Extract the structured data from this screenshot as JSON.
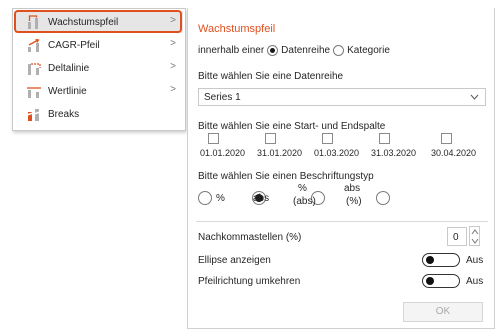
{
  "menu": {
    "items": [
      {
        "label": "Wachstumspfeil",
        "icon": "growth-arrow-icon",
        "submenu": true,
        "active": true
      },
      {
        "label": "CAGR-Pfeil",
        "icon": "cagr-arrow-icon",
        "submenu": true
      },
      {
        "label": "Deltalinie",
        "icon": "delta-line-icon",
        "submenu": true
      },
      {
        "label": "Wertlinie",
        "icon": "value-line-icon",
        "submenu": true
      },
      {
        "label": "Breaks",
        "icon": "breaks-icon",
        "submenu": false
      }
    ],
    "accent_color": "#e0501f",
    "submenu_glyph": ">"
  },
  "panel": {
    "title": "Wachstumspfeil",
    "scope": {
      "label": "innerhalb einer",
      "option_series": "Datenreihe",
      "option_category": "Kategorie",
      "selected": "Datenreihe"
    },
    "series_section": {
      "label": "Bitte wählen Sie eine Datenreihe",
      "selected": "Series 1"
    },
    "columns_section": {
      "label": "Bitte wählen Sie eine Start- und Endspalte",
      "dates": [
        "01.01.2020",
        "31.01.2020",
        "01.03.2020",
        "31.03.2020",
        "30.04.2020"
      ]
    },
    "label_type": {
      "label": "Bitte wählen Sie einen Beschriftungstyp",
      "opt_pct": "%",
      "opt_abs": "abs",
      "opt_pct_abs_line1": "%",
      "opt_pct_abs_line2": "(abs)",
      "opt_abs_pct_line1": "abs",
      "opt_abs_pct_line2": "(%)",
      "selected": "abs"
    },
    "decimals": {
      "label": "Nachkommastellen (%)",
      "value": "0"
    },
    "ellipse": {
      "label": "Ellipse anzeigen",
      "state": "Aus"
    },
    "reverse": {
      "label": "Pfeilrichtung umkehren",
      "state": "Aus"
    },
    "ok_label": "OK"
  }
}
